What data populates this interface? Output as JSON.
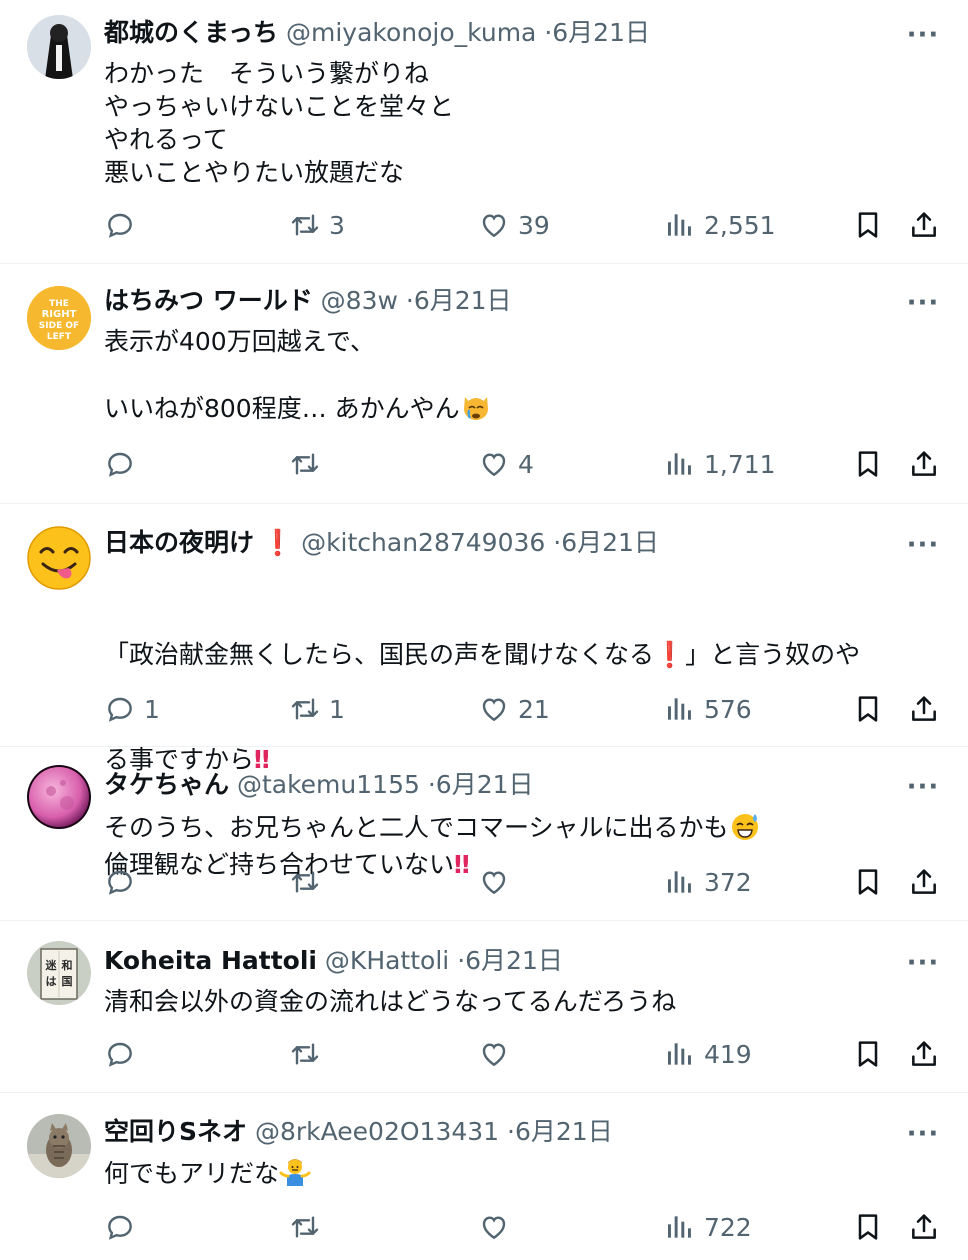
{
  "posts": [
    {
      "name": "都城のくまっち",
      "handle": "@miyakonojo_kuma",
      "date": "6月21日",
      "lines": "わかった　そういう繋がりね\nやっちゃいけないことを堂々と\nやれるって\n悪いことやりたい放題だな",
      "replies": "",
      "reposts": "3",
      "likes": "39",
      "views": "2,551"
    },
    {
      "name": "はちみつ ワールド",
      "handle": "@83w",
      "date": "6月21日",
      "avatar_text": "THE RIGHT SIDE OF LEFT",
      "lines": "表示が400万回越えで、\n\nいいねが800程度… あかんやん",
      "replies": "",
      "reposts": "",
      "likes": "4",
      "views": "1,711"
    },
    {
      "name": "日本の夜明け",
      "handle": "@kitchan28749036",
      "date": "6月21日",
      "lines": "「政治献金無くしたら、国民の声を聞けなくなる",
      "lines_b": "」と言う奴のや",
      "lines_c": "る事ですから",
      "lines_d": "倫理観など持ち合わせていない",
      "replies": "1",
      "reposts": "1",
      "likes": "21",
      "views": "576"
    },
    {
      "name": "タケちゃん",
      "handle": "@takemu1155",
      "date": "6月21日",
      "lines": "そのうち、お兄ちゃんと二人でコマーシャルに出るかも",
      "replies": "",
      "reposts": "",
      "likes": "",
      "views": "372"
    },
    {
      "name": "Koheita Hattoli",
      "handle": "@KHattoli",
      "date": "6月21日",
      "avatar_text": "和の国は迷わない",
      "lines": "清和会以外の資金の流れはどうなってるんだろうね",
      "replies": "",
      "reposts": "",
      "likes": "",
      "views": "419"
    },
    {
      "name": "空回りSネオ",
      "handle": "@8rkAee02O13431",
      "date": "6月21日",
      "lines": "何でもアリだな",
      "replies": "",
      "reposts": "",
      "likes": "",
      "views": "722"
    }
  ],
  "separator": "·",
  "colors": {
    "text": "#0f1419",
    "meta": "#536471",
    "divider": "#eff3f4",
    "red": "#e0245e"
  }
}
